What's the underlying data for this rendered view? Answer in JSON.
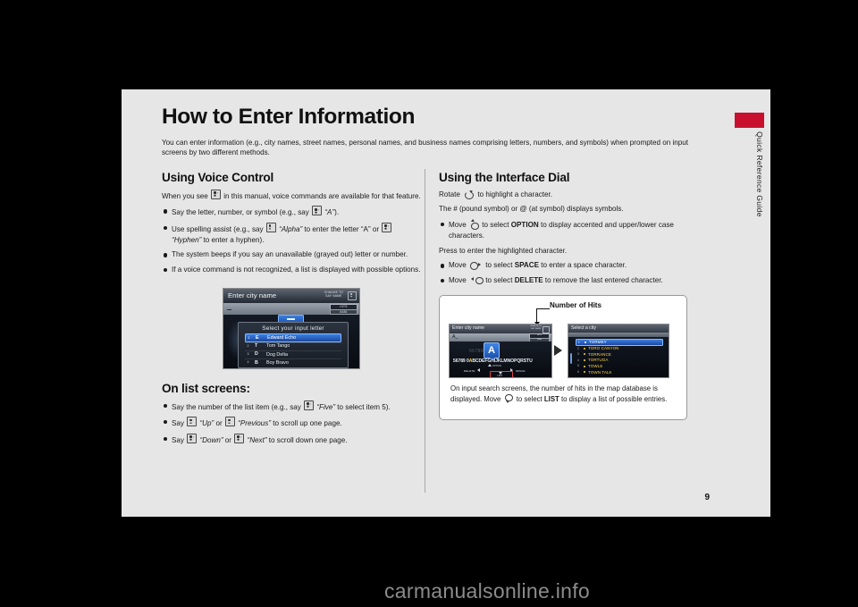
{
  "document": {
    "title": "How to Enter Information",
    "intro": "You can enter information (e.g., city names, street names, personal names, and business names comprising letters, numbers, and symbols) when prompted on input screens by two different methods.",
    "page_number": "9",
    "side_tab_label": "Quick Reference Guide",
    "watermark": "carmanualsonline.info",
    "accent_color": "#c8102e"
  },
  "left_column": {
    "section1_heading": "Using Voice Control",
    "section1_intro_a": "When you see",
    "section1_intro_b": "in this manual, voice commands are available for that feature.",
    "bullets": [
      {
        "a": "Say the letter, number, or symbol (e.g., say",
        "q1": "“A”",
        "b": ")."
      },
      {
        "a": "Use spelling assist (e.g., say",
        "q1": "“Alpha”",
        "b": "to enter the letter “A” or",
        "q2": "“Hyphen”",
        "c": "to enter a hyphen)."
      },
      {
        "a": "The system beeps if you say an unavailable (grayed out) letter or number."
      },
      {
        "a": "If a voice command is not recognized, a list is displayed with possible options."
      }
    ],
    "section2_heading": "On list screens:",
    "bullets2": [
      {
        "a": "Say the number of the list item (e.g., say",
        "q1": "“Five”",
        "b": "to select item 5)."
      },
      {
        "a": "Say",
        "q1": "“Up”",
        "b": "or",
        "q2": "“Previous”",
        "c": "to scroll up one page."
      },
      {
        "a": "Say",
        "q1": "“Down”",
        "b": "or",
        "q2": "“Next”",
        "c": "to scroll down one page."
      }
    ]
  },
  "right_column": {
    "heading": "Using the Interface Dial",
    "line_rotate_a": "Rotate",
    "line_rotate_b": "to highlight a character.",
    "line_pound": "The # (pound symbol) or @ (at symbol) displays symbols.",
    "bullet_option_a": "Move",
    "bullet_option_b": "to select",
    "bullet_option_key": "OPTION",
    "bullet_option_c": "to display accented and upper/lower case characters.",
    "line_press": "Press to enter the highlighted character.",
    "bullet_space_a": "Move",
    "bullet_space_b": "to select",
    "bullet_space_key": "SPACE",
    "bullet_space_c": "to enter a space character.",
    "bullet_delete_a": "Move",
    "bullet_delete_b": "to select",
    "bullet_delete_key": "DELETE",
    "bullet_delete_c": "to remove the last entered character."
  },
  "nav_screenshot": {
    "title": "Enter city name",
    "change_to": "CHANGE TO",
    "say_name": "SAY NAME",
    "hits_label": "HITS",
    "hits_value": "8486",
    "dialog_title": "Select your input letter",
    "rows": [
      {
        "num": "1",
        "letter": "E",
        "name": "Edward Echo",
        "selected": true
      },
      {
        "num": "2",
        "letter": "T",
        "name": "Tom Tango",
        "selected": false
      },
      {
        "num": "3",
        "letter": "D",
        "name": "Dog Delta",
        "selected": false
      },
      {
        "num": "4",
        "letter": "B",
        "name": "Boy Bravo",
        "selected": false
      }
    ]
  },
  "callout": {
    "label": "Number of Hits",
    "text_a": "On input search screens, the number of hits in the map database is displayed. Move",
    "text_b": "to select",
    "text_key": "LIST",
    "text_c": "to display a list of possible entries.",
    "screen_a": {
      "title": "Enter city name",
      "change_to": "CHANGE TO",
      "say_name": "SAY NAME",
      "entry_value": "A_",
      "hits_label": "HITS",
      "hits_value": "8486",
      "highlighted_char": "A",
      "alphabet_prefix": "56789 0",
      "alphabet_sel": "A",
      "alphabet_rest": "BCDEFGHIJKLMNOPQRSTU",
      "option_label": "OPTION",
      "delete_label": "DELETE",
      "space_label": "SPACE",
      "list_label": "LIST"
    },
    "screen_b": {
      "title": "Select a city",
      "rows": [
        {
          "num": "1",
          "name": "TORMEY",
          "selected": true
        },
        {
          "num": "2",
          "name": "TORO CANYON",
          "selected": false
        },
        {
          "num": "3",
          "name": "TORRANCE",
          "selected": false
        },
        {
          "num": "4",
          "name": "TORTUGA",
          "selected": false
        },
        {
          "num": "5",
          "name": "TOWLE",
          "selected": false
        },
        {
          "num": "6",
          "name": "TOWN TALK",
          "selected": false
        }
      ]
    }
  }
}
